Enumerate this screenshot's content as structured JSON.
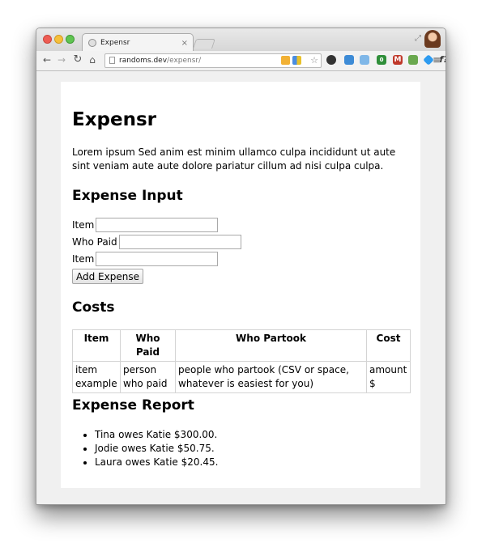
{
  "browser": {
    "tab_title": "Expensr",
    "tab_close": "×",
    "url_host": "randoms.dev",
    "url_path": "/expensr/",
    "icons": {
      "back": "arrow-left",
      "forward": "arrow-right",
      "reload": "reload",
      "home": "home",
      "star": "star",
      "menu": "hamburger"
    },
    "extension_colors": [
      "#f2b134",
      "#4a8de0",
      "#333333",
      "#3d8bd6",
      "#7fb7e8",
      "#2f8f3a",
      "#c0392b",
      "#6aa84f",
      "#2d9bf0"
    ],
    "extension_f_label": "f?"
  },
  "page": {
    "title": "Expensr",
    "intro": "Lorem ipsum Sed anim est minim ullamco culpa incididunt ut aute sint veniam aute aute dolore pariatur cillum ad nisi culpa culpa.",
    "expense_input": {
      "heading": "Expense Input",
      "fields": [
        {
          "label": "Item",
          "value": ""
        },
        {
          "label": "Who Paid",
          "value": ""
        },
        {
          "label": "Item",
          "value": ""
        }
      ],
      "add_button": "Add Expense"
    },
    "costs": {
      "heading": "Costs",
      "columns": [
        "Item",
        "Who Paid",
        "Who Partook",
        "Cost"
      ],
      "rows": [
        [
          "item example",
          "person who paid",
          "people who partook (CSV or space, whatever is easiest for you)",
          "amount $"
        ]
      ]
    },
    "report": {
      "heading": "Expense Report",
      "items": [
        "Tina owes Katie $300.00.",
        "Jodie owes Katie $50.75.",
        "Laura owes Katie $20.45."
      ]
    }
  }
}
